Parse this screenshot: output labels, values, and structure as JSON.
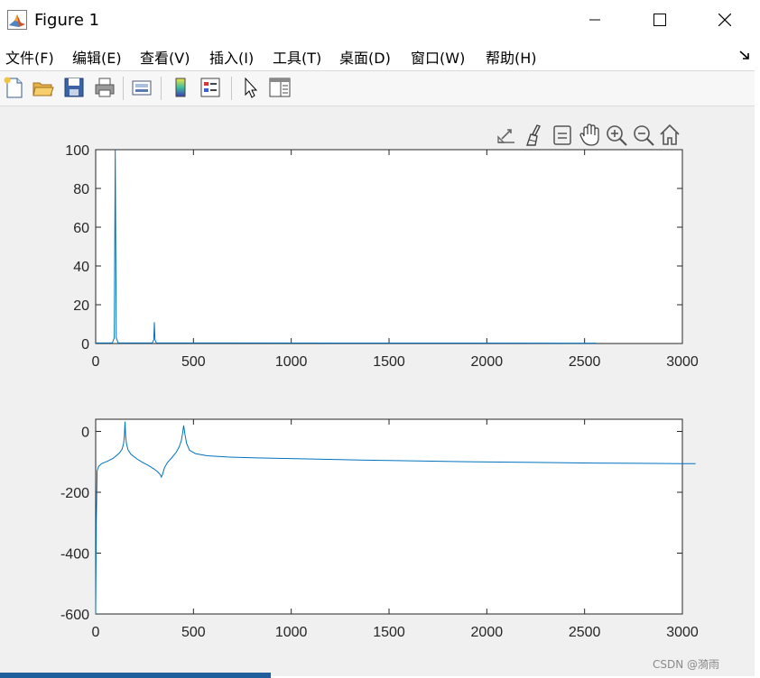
{
  "window": {
    "title": "Figure 1",
    "controls": {
      "minimize": "minimize",
      "maximize": "maximize",
      "close": "close"
    }
  },
  "menubar": {
    "items": [
      "文件(F)",
      "编辑(E)",
      "查看(V)",
      "插入(I)",
      "工具(T)",
      "桌面(D)",
      "窗口(W)",
      "帮助(H)"
    ],
    "mnemonic_letters": [
      "F",
      "E",
      "V",
      "I",
      "T",
      "D",
      "W",
      "H"
    ]
  },
  "toolbar": {
    "icons": [
      "new-figure-icon",
      "open-file-icon",
      "save-icon",
      "print-icon",
      "link-plot-icon",
      "colorbar-icon",
      "legend-icon",
      "edit-plot-pointer-icon",
      "property-inspector-icon"
    ]
  },
  "axes_toolbar": {
    "icons": [
      "export-icon",
      "brush-icon",
      "data-tips-icon",
      "pan-hand-icon",
      "zoom-in-icon",
      "zoom-out-icon",
      "home-icon"
    ]
  },
  "colors": {
    "line": "#0072bd",
    "window_bg": "#f0f0f0",
    "axes_bg": "#ffffff"
  },
  "chart_data": [
    {
      "type": "line",
      "title": "",
      "xlabel": "",
      "ylabel": "",
      "xlim": [
        0,
        3000
      ],
      "ylim": [
        0,
        100
      ],
      "xticks": [
        0,
        500,
        1000,
        1500,
        2000,
        2500,
        3000
      ],
      "yticks": [
        0,
        20,
        40,
        60,
        80,
        100
      ],
      "grid": false,
      "series": [
        {
          "x": [
            0,
            85,
            95,
            100,
            105,
            115,
            290,
            297,
            300,
            303,
            310,
            2560
          ],
          "y": [
            0.3,
            0.3,
            3,
            100,
            3,
            0.3,
            0.3,
            2,
            11,
            2,
            0.3,
            0.2
          ]
        }
      ]
    },
    {
      "type": "line",
      "title": "",
      "xlabel": "",
      "ylabel": "",
      "xlim": [
        0,
        2000
      ],
      "ylim": [
        -600,
        40
      ],
      "xtick_labels": [
        0,
        500,
        1000,
        1500,
        2000,
        2500,
        3000
      ],
      "yticks": [
        0,
        -200,
        -400,
        -600
      ],
      "grid": false,
      "series": [
        {
          "x": [
            0,
            2,
            5,
            10,
            20,
            40,
            60,
            80,
            90,
            95,
            98,
            100,
            102,
            105,
            110,
            120,
            140,
            160,
            180,
            200,
            210,
            220,
            224,
            228,
            235,
            245,
            260,
            275,
            285,
            292,
            296,
            300,
            304,
            310,
            320,
            340,
            380,
            450,
            550,
            700,
            900,
            1100,
            1300,
            1500,
            1700,
            1850,
            2000,
            2045
          ],
          "y": [
            -600,
            -300,
            -130,
            -115,
            -106,
            -98,
            -88,
            -72,
            -58,
            -40,
            -15,
            32,
            -15,
            -40,
            -60,
            -75,
            -90,
            -102,
            -112,
            -124,
            -132,
            -142,
            -150,
            -140,
            -118,
            -102,
            -86,
            -68,
            -50,
            -30,
            -8,
            20,
            -8,
            -40,
            -62,
            -73,
            -80,
            -84,
            -87,
            -90,
            -94,
            -97,
            -100,
            -102,
            -104,
            -105,
            -106,
            -106
          ]
        }
      ]
    }
  ]
}
